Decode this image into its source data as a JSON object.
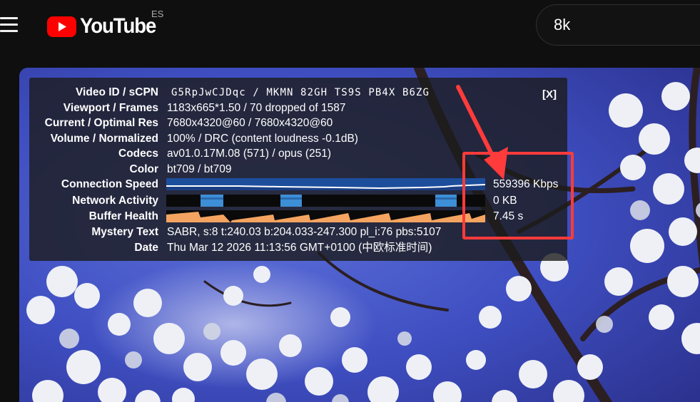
{
  "header": {
    "logo_text": "YouTube",
    "country_code": "ES",
    "search_value": "8k",
    "brand_color": "#ff0000"
  },
  "stats": {
    "close_label": "[X]",
    "rows": [
      {
        "label": "Video ID / sCPN",
        "value": "G5RpJwCJDqc / MKMN 82GH TS9S PB4X B6ZG"
      },
      {
        "label": "Viewport / Frames",
        "value": "1183x665*1.50 / 70 dropped of 1587"
      },
      {
        "label": "Current / Optimal Res",
        "value": "7680x4320@60 / 7680x4320@60"
      },
      {
        "label": "Volume / Normalized",
        "value": "100% / DRC (content loudness -0.1dB)"
      },
      {
        "label": "Codecs",
        "value": "av01.0.17M.08 (571) / opus (251)"
      },
      {
        "label": "Color",
        "value": "bt709 / bt709"
      },
      {
        "label": "Connection Speed",
        "value": "559396 Kbps"
      },
      {
        "label": "Network Activity",
        "value": "0 KB"
      },
      {
        "label": "Buffer Health",
        "value": "7.45 s"
      },
      {
        "label": "Mystery Text",
        "value": "SABR, s:8 t:240.03 b:204.033-247.300 pl_i:76 pbs:5107"
      },
      {
        "label": "Date",
        "value": "Thu Mar 12 2026 11:13:56 GMT+0100 (中欧标准时间)"
      }
    ],
    "colors": {
      "connection_graph": "#1c4e9c",
      "network_graph": "#3d8fd6",
      "buffer_graph": "#f4a460",
      "annotation": "#ff3b3b"
    }
  }
}
